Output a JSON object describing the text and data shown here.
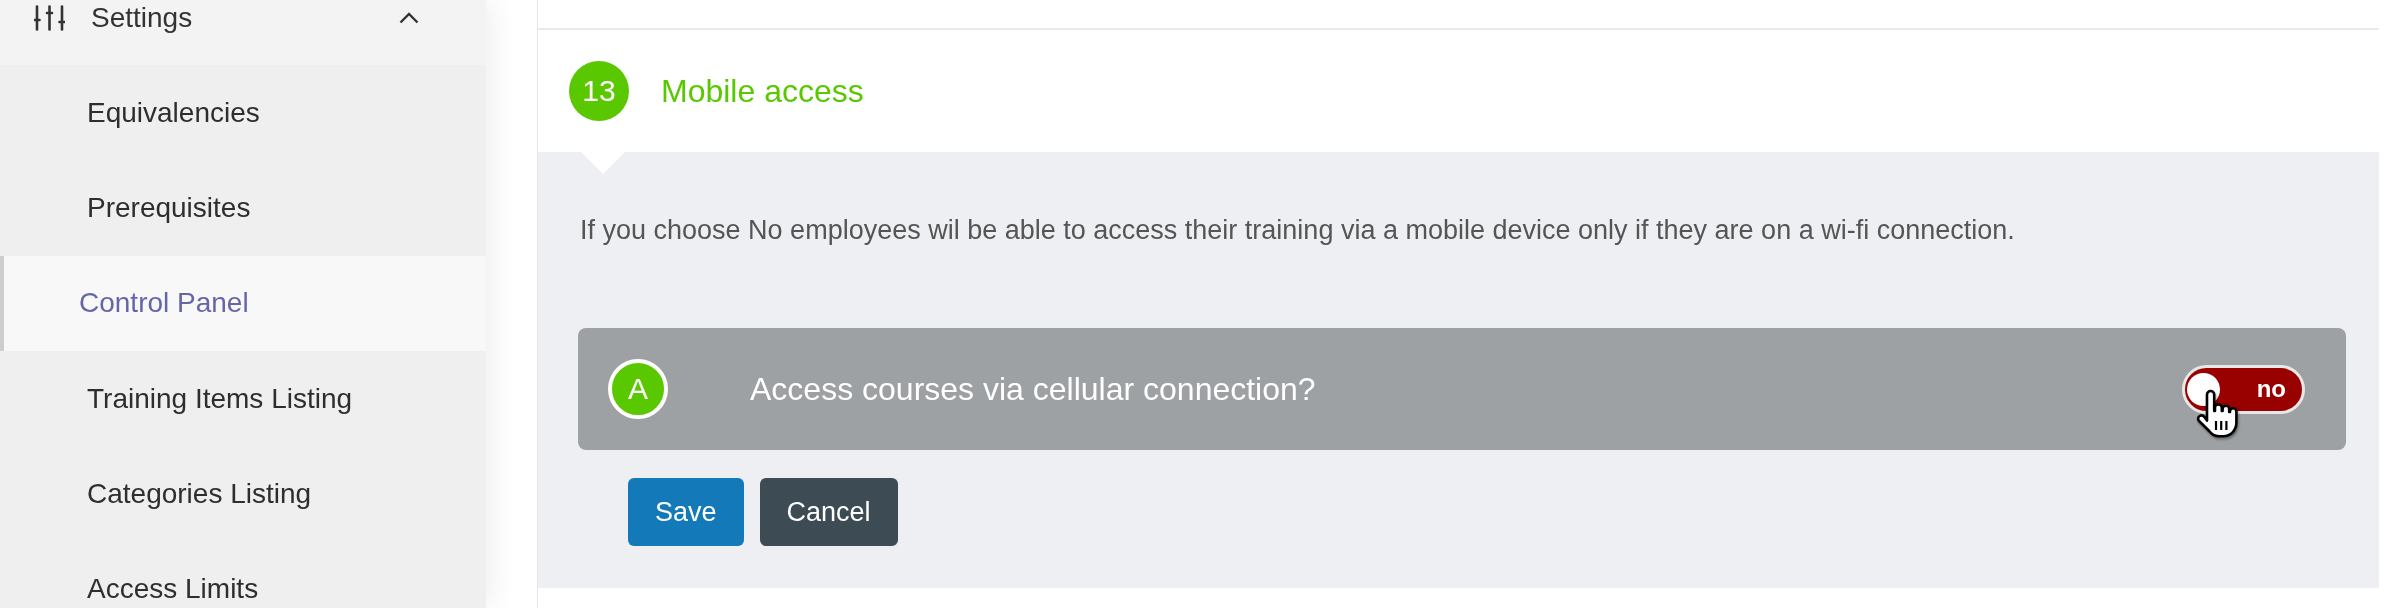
{
  "sidebar": {
    "section": {
      "label": "Settings",
      "expanded": true,
      "children": [
        {
          "label": "Equivalencies",
          "selected": false
        },
        {
          "label": "Prerequisites",
          "selected": false
        },
        {
          "label": "Control Panel",
          "selected": true
        },
        {
          "label": "Training Items Listing",
          "selected": false
        },
        {
          "label": "Categories Listing",
          "selected": false
        },
        {
          "label": "Access Limits",
          "selected": false
        }
      ]
    }
  },
  "section": {
    "number": "13",
    "title": "Mobile access",
    "description": "If you choose No employees wil be able to access their training via a mobile device only if they are on a wi-fi connection.",
    "questions": [
      {
        "letter": "A",
        "label": "Access courses via cellular connection?",
        "toggle": {
          "on": false,
          "label": "no"
        }
      }
    ],
    "buttons": [
      {
        "label": "Save",
        "kind": "primary"
      },
      {
        "label": "Cancel",
        "kind": "secondary"
      }
    ]
  }
}
